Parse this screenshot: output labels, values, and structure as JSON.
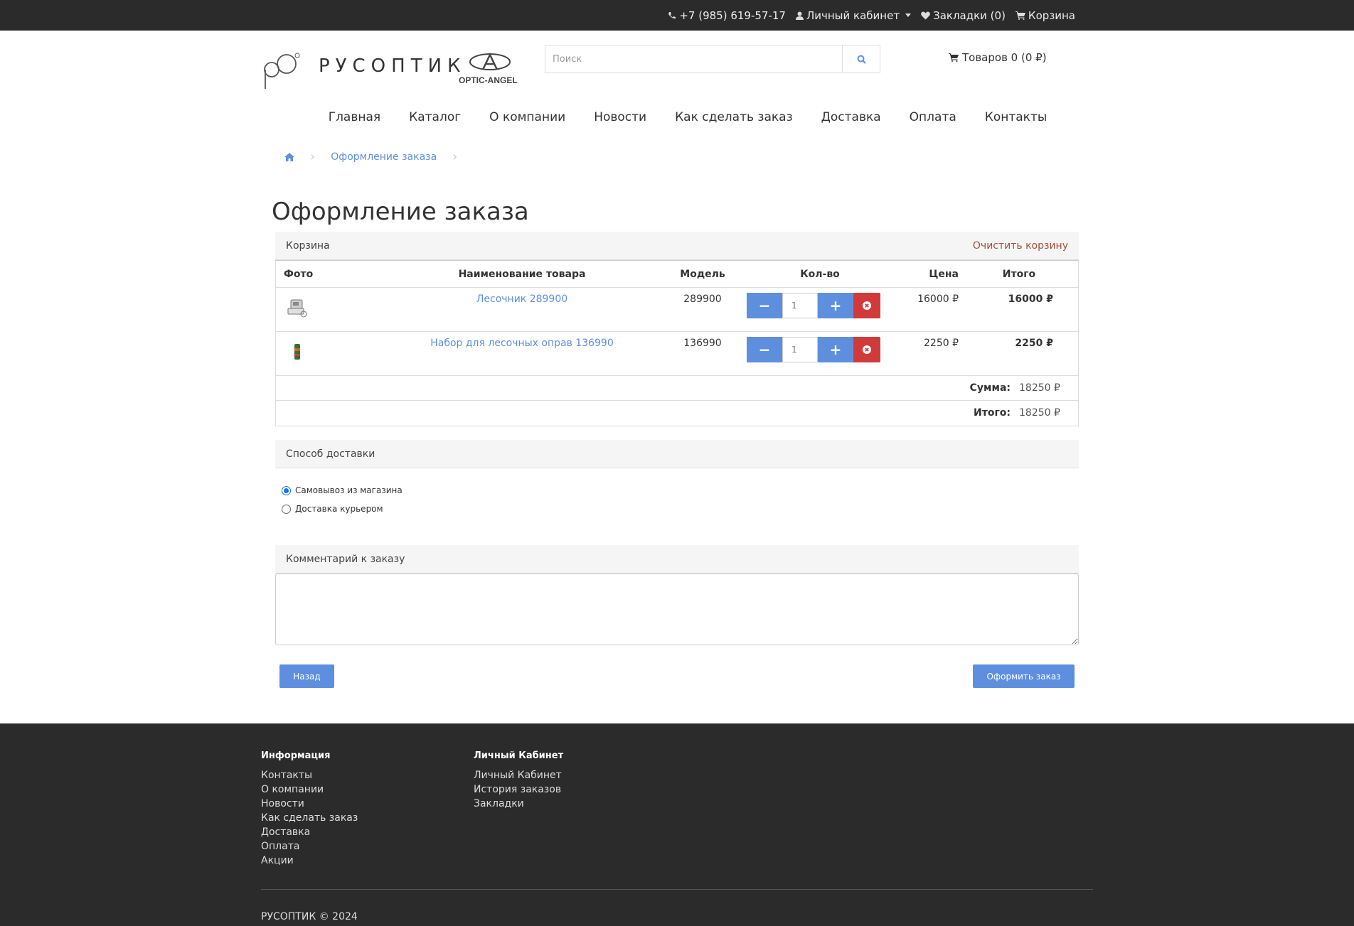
{
  "topbar": {
    "phone": "+7 (985) 619-57-17",
    "account": "Личный кабинет",
    "wishlist": "Закладки (0)",
    "cart": "Корзина"
  },
  "header": {
    "logo_text": "РУСОПТИК",
    "logo_sub": "OPTIC-ANGEL",
    "search_placeholder": "Поиск",
    "cart_summary": "Товаров 0 (0 ₽)"
  },
  "menu": [
    "Главная",
    "Каталог",
    "О компании",
    "Новости",
    "Как сделать заказ",
    "Доставка",
    "Оплата",
    "Контакты"
  ],
  "breadcrumb": {
    "current": "Оформление заказа"
  },
  "page_title": "Оформление заказа",
  "cart": {
    "title": "Корзина",
    "clear": "Очистить корзину",
    "headers": {
      "photo": "Фото",
      "name": "Наименование товара",
      "model": "Модель",
      "qty": "Кол-во",
      "price": "Цена",
      "total": "Итого"
    },
    "items": [
      {
        "name": "Лесочник 289900",
        "model": "289900",
        "qty": "1",
        "price": "16000 ₽",
        "total": "16000 ₽"
      },
      {
        "name": "Набор для лесочных оправ 136990",
        "model": "136990",
        "qty": "1",
        "price": "2250 ₽",
        "total": "2250 ₽"
      }
    ],
    "subtotal_label": "Сумма:",
    "subtotal": "18250 ₽",
    "total_label": "Итого:",
    "total": "18250 ₽"
  },
  "shipping": {
    "title": "Способ доставки",
    "options": [
      {
        "label": "Самовывоз из магазина",
        "selected": true
      },
      {
        "label": "Доставка курьером",
        "selected": false
      }
    ]
  },
  "comment": {
    "title": "Комментарий к заказу",
    "value": ""
  },
  "buttons": {
    "back": "Назад",
    "checkout": "Оформить заказ"
  },
  "footer": {
    "info_title": "Информация",
    "info_links": [
      "Контакты",
      "О компании",
      "Новости",
      "Как сделать заказ",
      "Доставка",
      "Оплата",
      "Акции"
    ],
    "account_title": "Личный Кабинет",
    "account_links": [
      "Личный Кабинет",
      "История заказов",
      "Закладки"
    ],
    "copyright": "РУСОПТИК © 2024"
  },
  "colors": {
    "accent": "#5e8fdf",
    "danger": "#d13a3a",
    "dark": "#2b2b2b",
    "clear_link": "#a0513d"
  }
}
